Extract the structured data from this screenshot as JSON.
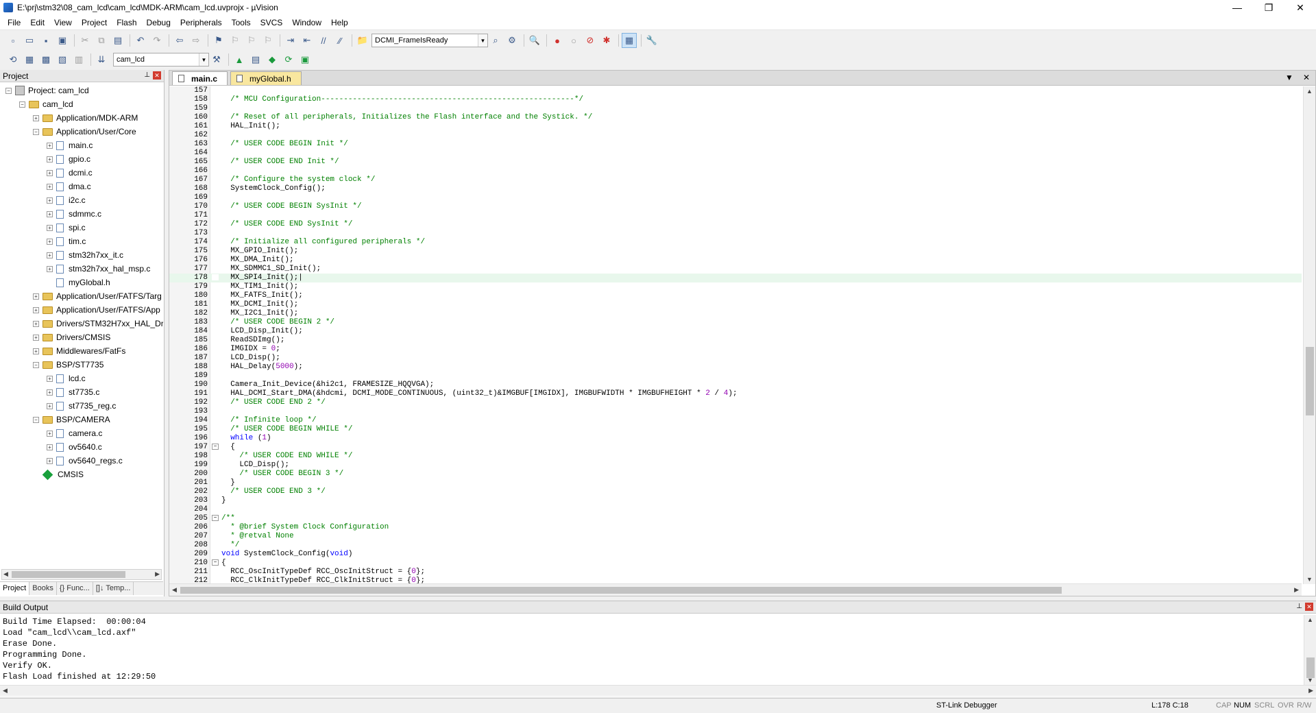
{
  "window": {
    "title": "E:\\prj\\stm32\\08_cam_lcd\\cam_lcd\\MDK-ARM\\cam_lcd.uvprojx - µVision",
    "controls": {
      "minimize": "—",
      "maximize": "❐",
      "close": "✕"
    }
  },
  "menu": [
    "File",
    "Edit",
    "View",
    "Project",
    "Flash",
    "Debug",
    "Peripherals",
    "Tools",
    "SVCS",
    "Window",
    "Help"
  ],
  "toolbar1": {
    "find_combo": "DCMI_FrameIsReady"
  },
  "toolbar2": {
    "target_combo": "cam_lcd"
  },
  "project_panel": {
    "title": "Project",
    "tree": [
      {
        "label": "Project: cam_lcd",
        "depth": 0,
        "icon": "project-icon",
        "expander": "−"
      },
      {
        "label": "cam_lcd",
        "depth": 1,
        "icon": "folder-icon",
        "expander": "−"
      },
      {
        "label": "Application/MDK-ARM",
        "depth": 2,
        "icon": "folder-icon",
        "expander": "+"
      },
      {
        "label": "Application/User/Core",
        "depth": 2,
        "icon": "folder-icon",
        "expander": "−"
      },
      {
        "label": "main.c",
        "depth": 3,
        "icon": "file-icon",
        "expander": "+"
      },
      {
        "label": "gpio.c",
        "depth": 3,
        "icon": "file-icon",
        "expander": "+"
      },
      {
        "label": "dcmi.c",
        "depth": 3,
        "icon": "file-icon",
        "expander": "+"
      },
      {
        "label": "dma.c",
        "depth": 3,
        "icon": "file-icon",
        "expander": "+"
      },
      {
        "label": "i2c.c",
        "depth": 3,
        "icon": "file-icon",
        "expander": "+"
      },
      {
        "label": "sdmmc.c",
        "depth": 3,
        "icon": "file-icon",
        "expander": "+"
      },
      {
        "label": "spi.c",
        "depth": 3,
        "icon": "file-icon",
        "expander": "+"
      },
      {
        "label": "tim.c",
        "depth": 3,
        "icon": "file-icon",
        "expander": "+"
      },
      {
        "label": "stm32h7xx_it.c",
        "depth": 3,
        "icon": "file-icon",
        "expander": "+"
      },
      {
        "label": "stm32h7xx_hal_msp.c",
        "depth": 3,
        "icon": "file-icon",
        "expander": "+"
      },
      {
        "label": "myGlobal.h",
        "depth": 3,
        "icon": "file-icon",
        "expander": ""
      },
      {
        "label": "Application/User/FATFS/Targ",
        "depth": 2,
        "icon": "folder-icon",
        "expander": "+"
      },
      {
        "label": "Application/User/FATFS/App",
        "depth": 2,
        "icon": "folder-icon",
        "expander": "+"
      },
      {
        "label": "Drivers/STM32H7xx_HAL_Dri",
        "depth": 2,
        "icon": "folder-icon",
        "expander": "+"
      },
      {
        "label": "Drivers/CMSIS",
        "depth": 2,
        "icon": "folder-icon",
        "expander": "+"
      },
      {
        "label": "Middlewares/FatFs",
        "depth": 2,
        "icon": "folder-icon",
        "expander": "+"
      },
      {
        "label": "BSP/ST7735",
        "depth": 2,
        "icon": "folder-icon",
        "expander": "−"
      },
      {
        "label": "lcd.c",
        "depth": 3,
        "icon": "file-icon",
        "expander": "+"
      },
      {
        "label": "st7735.c",
        "depth": 3,
        "icon": "file-icon",
        "expander": "+"
      },
      {
        "label": "st7735_reg.c",
        "depth": 3,
        "icon": "file-icon",
        "expander": "+"
      },
      {
        "label": "BSP/CAMERA",
        "depth": 2,
        "icon": "folder-icon",
        "expander": "−"
      },
      {
        "label": "camera.c",
        "depth": 3,
        "icon": "file-icon",
        "expander": "+"
      },
      {
        "label": "ov5640.c",
        "depth": 3,
        "icon": "file-icon",
        "expander": "+"
      },
      {
        "label": "ov5640_regs.c",
        "depth": 3,
        "icon": "file-icon",
        "expander": "+"
      },
      {
        "label": "CMSIS",
        "depth": 2,
        "icon": "green-diamond-icon",
        "expander": ""
      }
    ],
    "tabs": [
      "Project",
      "Books",
      "{} Func...",
      "[]↓ Temp..."
    ]
  },
  "editor": {
    "tabs": [
      {
        "label": "main.c",
        "active": true
      },
      {
        "label": "myGlobal.h",
        "active": false
      }
    ],
    "current_line": 178,
    "lines": [
      {
        "n": "157",
        "fold": "",
        "parts": []
      },
      {
        "n": "158",
        "fold": "",
        "parts": [
          {
            "t": "  "
          },
          {
            "c": "/* MCU Configuration--------------------------------------------------------*/"
          }
        ]
      },
      {
        "n": "159",
        "fold": "",
        "parts": []
      },
      {
        "n": "160",
        "fold": "",
        "parts": [
          {
            "t": "  "
          },
          {
            "c": "/* Reset of all peripherals, Initializes the Flash interface and the Systick. */"
          }
        ]
      },
      {
        "n": "161",
        "fold": "",
        "parts": [
          {
            "t": "  HAL_Init();"
          }
        ]
      },
      {
        "n": "162",
        "fold": "",
        "parts": []
      },
      {
        "n": "163",
        "fold": "",
        "parts": [
          {
            "t": "  "
          },
          {
            "c": "/* USER CODE BEGIN Init */"
          }
        ]
      },
      {
        "n": "164",
        "fold": "",
        "parts": []
      },
      {
        "n": "165",
        "fold": "",
        "parts": [
          {
            "t": "  "
          },
          {
            "c": "/* USER CODE END Init */"
          }
        ]
      },
      {
        "n": "166",
        "fold": "",
        "parts": []
      },
      {
        "n": "167",
        "fold": "",
        "parts": [
          {
            "t": "  "
          },
          {
            "c": "/* Configure the system clock */"
          }
        ]
      },
      {
        "n": "168",
        "fold": "",
        "parts": [
          {
            "t": "  SystemClock_Config();"
          }
        ]
      },
      {
        "n": "169",
        "fold": "",
        "parts": []
      },
      {
        "n": "170",
        "fold": "",
        "parts": [
          {
            "t": "  "
          },
          {
            "c": "/* USER CODE BEGIN SysInit */"
          }
        ]
      },
      {
        "n": "171",
        "fold": "",
        "parts": []
      },
      {
        "n": "172",
        "fold": "",
        "parts": [
          {
            "t": "  "
          },
          {
            "c": "/* USER CODE END SysInit */"
          }
        ]
      },
      {
        "n": "173",
        "fold": "",
        "parts": []
      },
      {
        "n": "174",
        "fold": "",
        "parts": [
          {
            "t": "  "
          },
          {
            "c": "/* Initialize all configured peripherals */"
          }
        ]
      },
      {
        "n": "175",
        "fold": "",
        "parts": [
          {
            "t": "  MX_GPIO_Init();"
          }
        ]
      },
      {
        "n": "176",
        "fold": "",
        "parts": [
          {
            "t": "  MX_DMA_Init();"
          }
        ]
      },
      {
        "n": "177",
        "fold": "",
        "parts": [
          {
            "t": "  MX_SDMMC1_SD_Init();"
          }
        ]
      },
      {
        "n": "178",
        "fold": "",
        "parts": [
          {
            "t": "  MX_SPI4_Init();|"
          }
        ]
      },
      {
        "n": "179",
        "fold": "",
        "parts": [
          {
            "t": "  MX_TIM1_Init();"
          }
        ]
      },
      {
        "n": "180",
        "fold": "",
        "parts": [
          {
            "t": "  MX_FATFS_Init();"
          }
        ]
      },
      {
        "n": "181",
        "fold": "",
        "parts": [
          {
            "t": "  MX_DCMI_Init();"
          }
        ]
      },
      {
        "n": "182",
        "fold": "",
        "parts": [
          {
            "t": "  MX_I2C1_Init();"
          }
        ]
      },
      {
        "n": "183",
        "fold": "",
        "parts": [
          {
            "t": "  "
          },
          {
            "c": "/* USER CODE BEGIN 2 */"
          }
        ]
      },
      {
        "n": "184",
        "fold": "",
        "parts": [
          {
            "t": "  LCD_Disp_Init();"
          }
        ]
      },
      {
        "n": "185",
        "fold": "",
        "parts": [
          {
            "t": "  ReadSDImg();"
          }
        ]
      },
      {
        "n": "186",
        "fold": "",
        "parts": [
          {
            "t": "  IMGIDX = "
          },
          {
            "n": "0"
          },
          {
            "t": ";"
          }
        ]
      },
      {
        "n": "187",
        "fold": "",
        "parts": [
          {
            "t": "  LCD_Disp();"
          }
        ]
      },
      {
        "n": "188",
        "fold": "",
        "parts": [
          {
            "t": "  HAL_Delay("
          },
          {
            "n": "5000"
          },
          {
            "t": ");"
          }
        ]
      },
      {
        "n": "189",
        "fold": "",
        "parts": []
      },
      {
        "n": "190",
        "fold": "",
        "parts": [
          {
            "t": "  Camera_Init_Device(&hi2c1, FRAMESIZE_HQQVGA);"
          }
        ]
      },
      {
        "n": "191",
        "fold": "",
        "parts": [
          {
            "t": "  HAL_DCMI_Start_DMA(&hdcmi, DCMI_MODE_CONTINUOUS, (uint32_t)&IMGBUF[IMGIDX], IMGBUFWIDTH * IMGBUFHEIGHT * "
          },
          {
            "n": "2"
          },
          {
            "t": " / "
          },
          {
            "n": "4"
          },
          {
            "t": ");"
          }
        ]
      },
      {
        "n": "192",
        "fold": "",
        "parts": [
          {
            "t": "  "
          },
          {
            "c": "/* USER CODE END 2 */"
          }
        ]
      },
      {
        "n": "193",
        "fold": "",
        "parts": []
      },
      {
        "n": "194",
        "fold": "",
        "parts": [
          {
            "t": "  "
          },
          {
            "c": "/* Infinite loop */"
          }
        ]
      },
      {
        "n": "195",
        "fold": "",
        "parts": [
          {
            "t": "  "
          },
          {
            "c": "/* USER CODE BEGIN WHILE */"
          }
        ]
      },
      {
        "n": "196",
        "fold": "",
        "parts": [
          {
            "t": "  "
          },
          {
            "k": "while"
          },
          {
            "t": " ("
          },
          {
            "n": "1"
          },
          {
            "t": ")"
          }
        ]
      },
      {
        "n": "197",
        "fold": "−",
        "parts": [
          {
            "t": "  {"
          }
        ]
      },
      {
        "n": "198",
        "fold": "",
        "parts": [
          {
            "t": "    "
          },
          {
            "c": "/* USER CODE END WHILE */"
          }
        ]
      },
      {
        "n": "199",
        "fold": "",
        "parts": [
          {
            "t": "    LCD_Disp();"
          }
        ]
      },
      {
        "n": "200",
        "fold": "",
        "parts": [
          {
            "t": "    "
          },
          {
            "c": "/* USER CODE BEGIN 3 */"
          }
        ]
      },
      {
        "n": "201",
        "fold": "",
        "parts": [
          {
            "t": "  }"
          }
        ]
      },
      {
        "n": "202",
        "fold": "",
        "parts": [
          {
            "t": "  "
          },
          {
            "c": "/* USER CODE END 3 */"
          }
        ]
      },
      {
        "n": "203",
        "fold": "",
        "parts": [
          {
            "t": "}"
          }
        ]
      },
      {
        "n": "204",
        "fold": "",
        "parts": []
      },
      {
        "n": "205",
        "fold": "−",
        "parts": [
          {
            "c": "/**"
          }
        ]
      },
      {
        "n": "206",
        "fold": "",
        "parts": [
          {
            "c": "  * @brief System Clock Configuration"
          }
        ]
      },
      {
        "n": "207",
        "fold": "",
        "parts": [
          {
            "c": "  * @retval None"
          }
        ]
      },
      {
        "n": "208",
        "fold": "",
        "parts": [
          {
            "c": "  */"
          }
        ]
      },
      {
        "n": "209",
        "fold": "",
        "parts": [
          {
            "k": "void"
          },
          {
            "t": " SystemClock_Config("
          },
          {
            "k": "void"
          },
          {
            "t": ")"
          }
        ]
      },
      {
        "n": "210",
        "fold": "−",
        "parts": [
          {
            "t": "{"
          }
        ]
      },
      {
        "n": "211",
        "fold": "",
        "parts": [
          {
            "t": "  RCC_OscInitTypeDef RCC_OscInitStruct = {"
          },
          {
            "n": "0"
          },
          {
            "t": "};"
          }
        ]
      },
      {
        "n": "212",
        "fold": "",
        "parts": [
          {
            "t": "  RCC_ClkInitTypeDef RCC_ClkInitStruct = {"
          },
          {
            "n": "0"
          },
          {
            "t": "};"
          }
        ]
      }
    ]
  },
  "build_output": {
    "title": "Build Output",
    "lines": [
      "Build Time Elapsed:  00:00:04",
      "Load \"cam_lcd\\\\cam_lcd.axf\"",
      "Erase Done.",
      "Programming Done.",
      "Verify OK.",
      "Flash Load finished at 12:29:50"
    ]
  },
  "status_bar": {
    "debugger": "ST-Link Debugger",
    "position": "L:178 C:18",
    "caps": "CAP",
    "num": "NUM",
    "scrl": "SCRL",
    "ovr": "OVR",
    "rw": "R/W"
  },
  "colors": {
    "comment": "#008000",
    "keyword": "#0000ff",
    "number": "#9000b0",
    "current_line": "#e8f7ec",
    "active_tab_yellow": "#f9e79f"
  }
}
